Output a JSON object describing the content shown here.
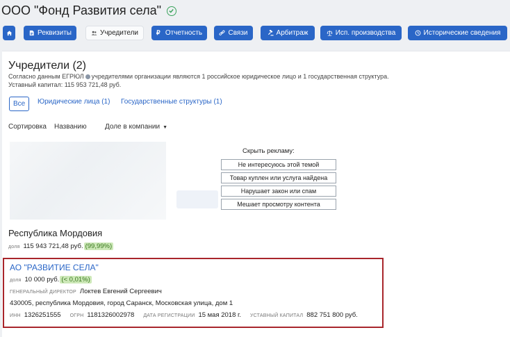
{
  "header": {
    "title": "ООО \"Фонд Развития села\"",
    "verified_icon": "check-circle-icon"
  },
  "tabs": [
    {
      "label": "",
      "icon": "home-icon"
    },
    {
      "label": "Реквизиты",
      "icon": "document-icon"
    },
    {
      "label": "Учредители",
      "icon": "people-icon",
      "active": true
    },
    {
      "label": "Отчетность",
      "icon": "ruble-icon"
    },
    {
      "label": "Связи",
      "icon": "link-icon"
    },
    {
      "label": "Арбитраж",
      "icon": "gavel-icon"
    },
    {
      "label": "Исп. производства",
      "icon": "scales-icon"
    },
    {
      "label": "Исторические сведения",
      "icon": "history-icon"
    }
  ],
  "founders": {
    "title": "Учредители (2)",
    "desc_before": "Согласно данным ЕГРЮЛ",
    "desc_after": "учредителями организации являются 1 российское юридическое лицо и 1 государственная структура.",
    "capital": "Уставный капитал: 115 953 721,48 руб."
  },
  "filters": {
    "all": "Все",
    "legal": "Юридические лица (1)",
    "gov": "Государственные структуры (1)"
  },
  "sort": {
    "label": "Сортировка",
    "by_name": "Названию",
    "by_share": "Доле в компании"
  },
  "ad": {
    "hide_title": "Скрыть рекламу:",
    "options": [
      "Не интересуюсь этой темой",
      "Товар куплен или услуга найдена",
      "Нарушает закон или спам",
      "Мешает просмотру контента"
    ]
  },
  "owner1": {
    "name": "Республика Мордовия",
    "share_label": "доля",
    "share_value": "115 943 721,48 руб.",
    "share_pct": "(99,99%)"
  },
  "owner2": {
    "name": "АО \"РАЗВИТИЕ СЕЛА\"",
    "share_label": "доля",
    "share_value": "10 000 руб.",
    "share_pct": "(< 0,01%)",
    "director_label": "генеральный директор",
    "director": "Локтев Евгений Сергеевич",
    "address": "430005, республика Мордовия, город Саранск, Московская улица, дом 1",
    "inn_label": "ИНН",
    "inn": "1326251555",
    "ogrn_label": "ОГРН",
    "ogrn": "1181326002978",
    "reg_label": "дата регистрации",
    "reg": "15 мая 2018 г.",
    "cap_label": "уставный капитал",
    "cap": "882 751 800 руб."
  }
}
